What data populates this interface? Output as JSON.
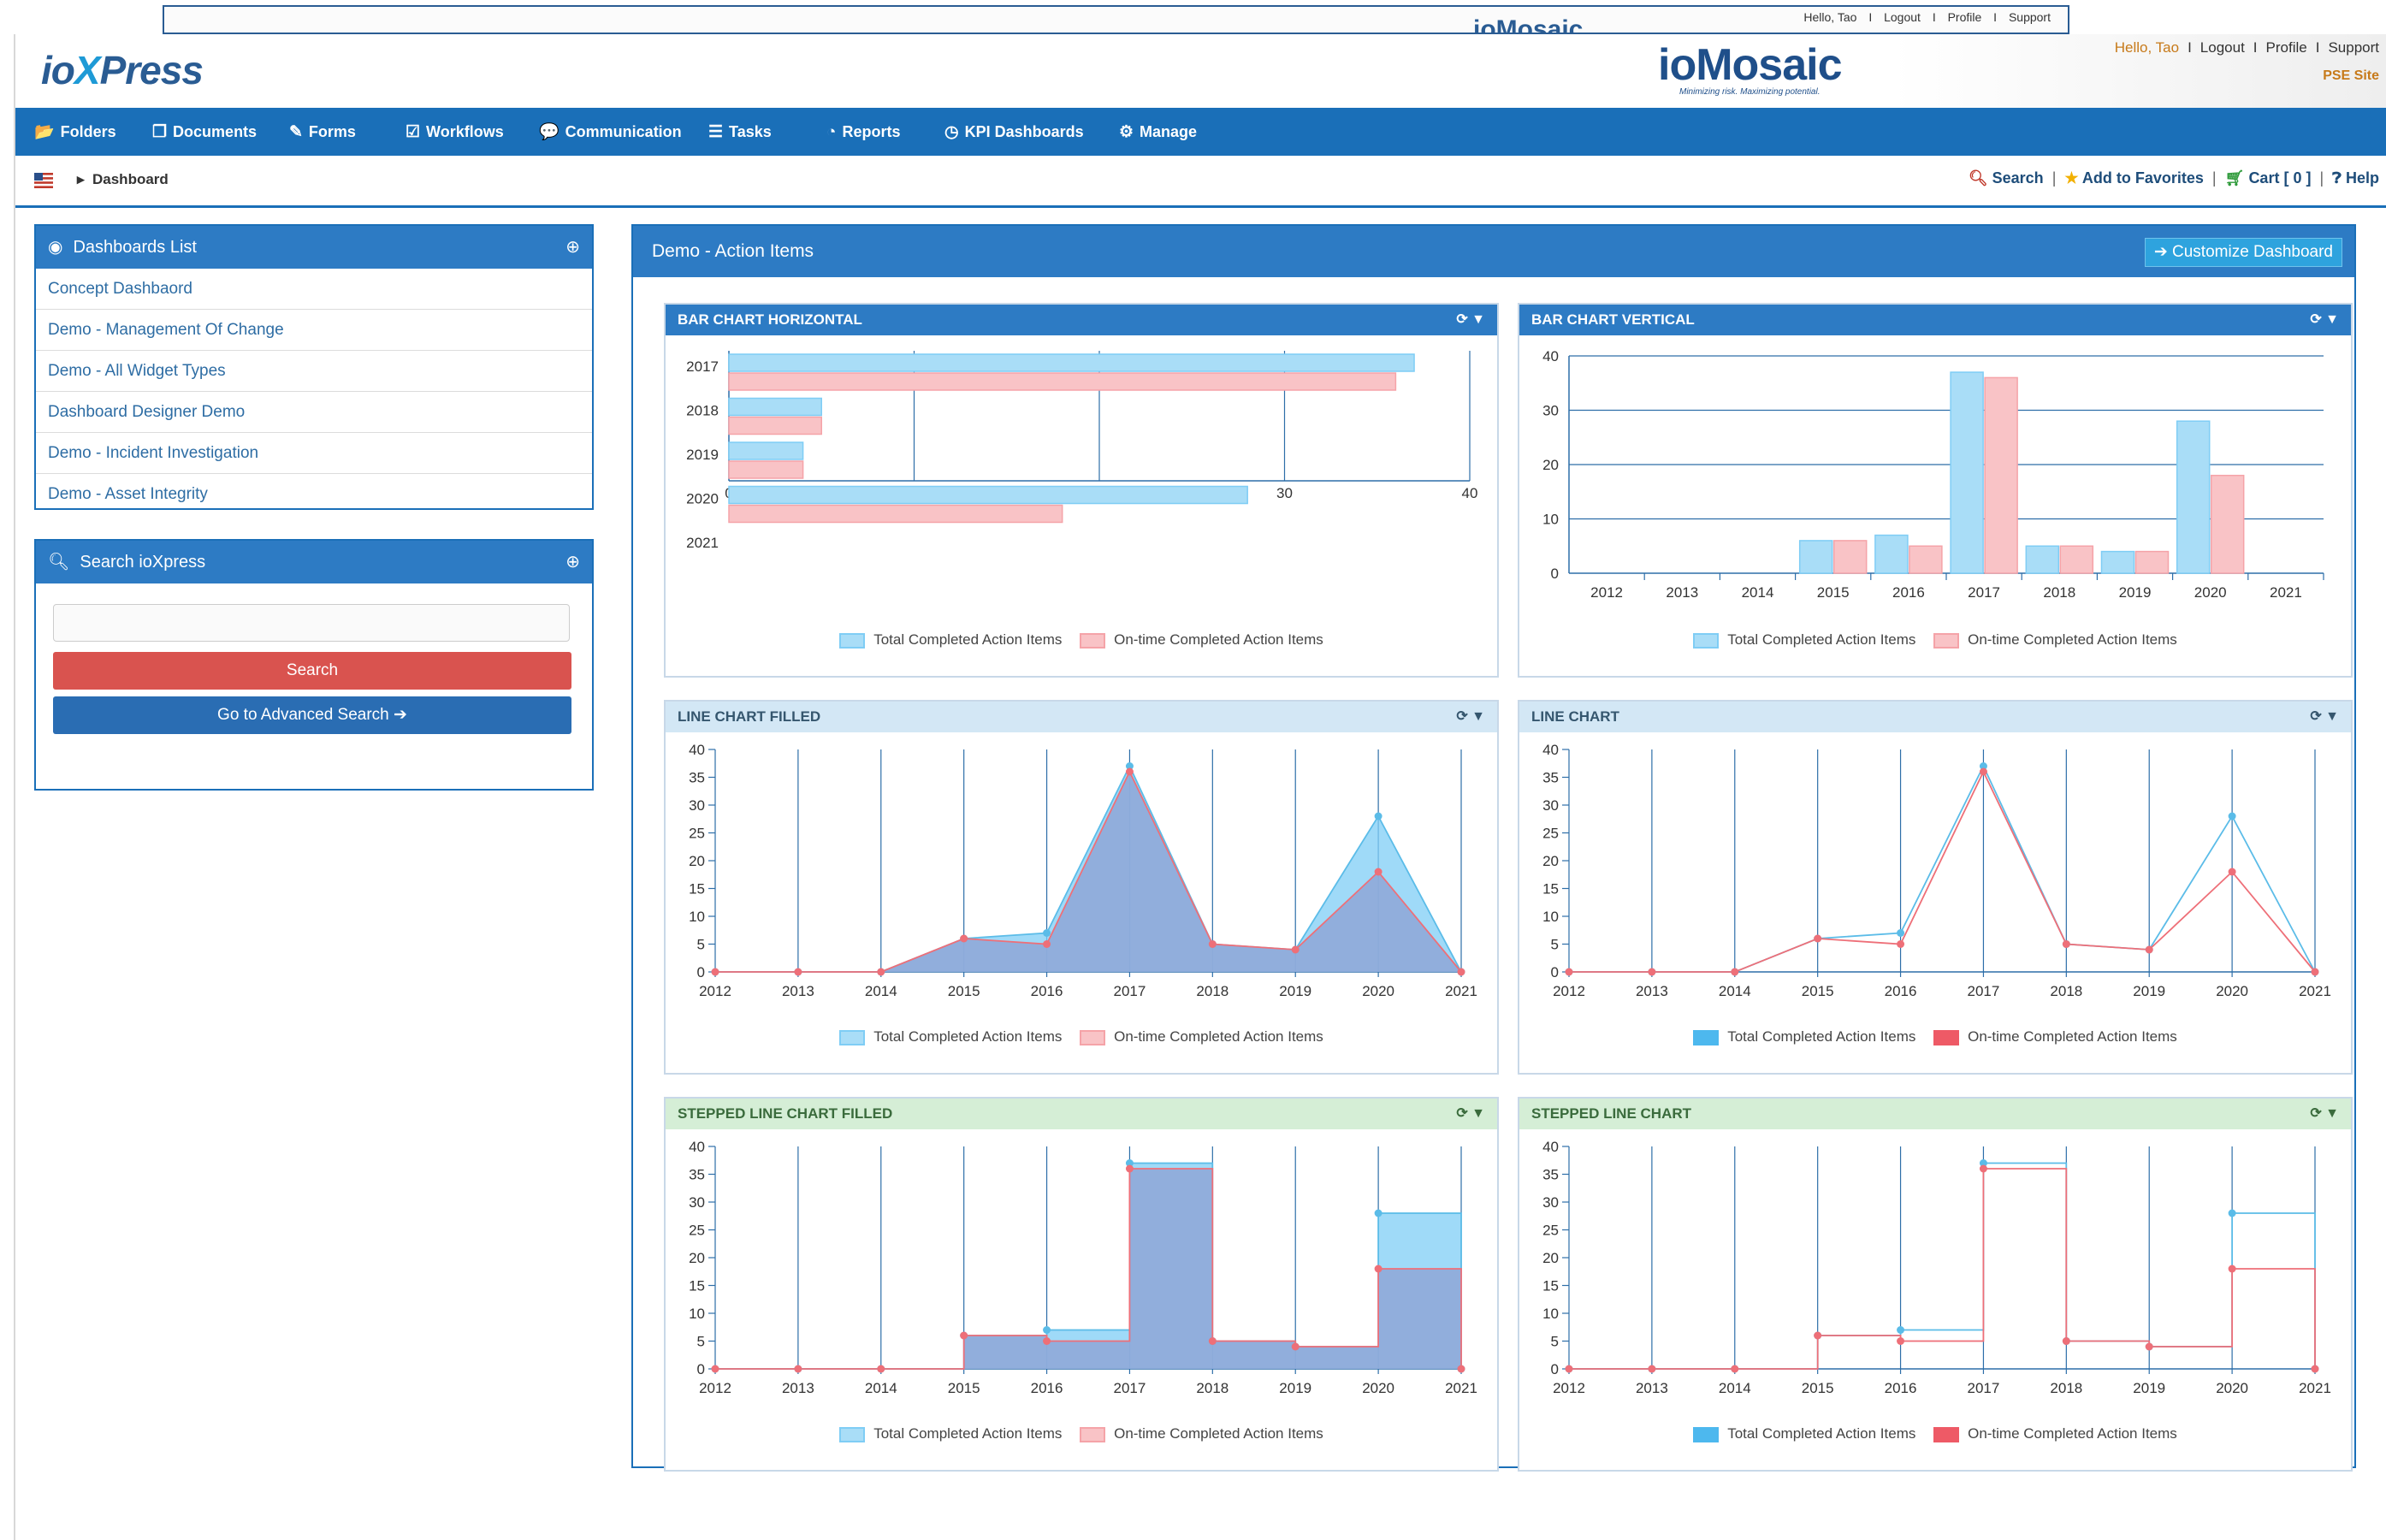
{
  "ghost": {
    "logo": "ioMosaic",
    "links": [
      "Hello, Tao",
      "I",
      "Logout",
      "I",
      "Profile",
      "I",
      "Support"
    ]
  },
  "header": {
    "logo_left": {
      "part1": "io",
      "part2": "X",
      "part3": "Press"
    },
    "logo_center": {
      "name": "ioMosaic",
      "tagline": "Minimizing risk. Maximizing potential."
    },
    "user_links": {
      "hello": "Hello, Tao",
      "logout": "Logout",
      "profile": "Profile",
      "support": "Support",
      "sep": "I"
    },
    "pse_site": "PSE Site"
  },
  "nav": {
    "items": [
      {
        "label": "Folders",
        "icon": "folder-open-icon"
      },
      {
        "label": "Documents",
        "icon": "documents-icon"
      },
      {
        "label": "Forms",
        "icon": "edit-icon"
      },
      {
        "label": "Workflows",
        "icon": "check-square-icon"
      },
      {
        "label": "Communication",
        "icon": "comments-icon"
      },
      {
        "label": "Tasks",
        "icon": "list-icon"
      },
      {
        "label": "Reports",
        "icon": "pie-chart-icon"
      },
      {
        "label": "KPI Dashboards",
        "icon": "tachometer-icon"
      },
      {
        "label": "Manage",
        "icon": "cogs-icon"
      }
    ]
  },
  "breadcrumb": {
    "current": "Dashboard"
  },
  "toolbar": {
    "search": "Search",
    "favorites": "Add to Favorites",
    "cart": "Cart [ 0 ]",
    "help": "Help",
    "pipe": "|"
  },
  "sidebar": {
    "dashboards_title": "Dashboards List",
    "dashboards": [
      "Concept Dashbaord",
      "Demo - Management Of Change",
      "Demo - All Widget Types",
      "Dashboard Designer Demo",
      "Demo - Incident Investigation",
      "Demo - Asset Integrity"
    ],
    "search_title": "Search ioXpress",
    "search_placeholder": "",
    "search_button": "Search",
    "advanced_button": "Go to Advanced Search ➔"
  },
  "main": {
    "title": "Demo - Action Items",
    "customize": "➔ Customize Dashboard"
  },
  "widgets": [
    {
      "id": "w1",
      "title": "BAR CHART HORIZONTAL",
      "legend": [
        "Total Completed Action Items",
        "On-time Completed Action Items"
      ]
    },
    {
      "id": "w2",
      "title": "BAR CHART VERTICAL",
      "legend": [
        "Total Completed Action Items",
        "On-time Completed Action Items"
      ]
    },
    {
      "id": "w3",
      "title": "LINE CHART FILLED",
      "legend": [
        "Total Completed Action Items",
        "On-time Completed Action Items"
      ]
    },
    {
      "id": "w4",
      "title": "LINE CHART",
      "legend": [
        "Total Completed Action Items",
        "On-time Completed Action Items"
      ]
    },
    {
      "id": "w5",
      "title": "STEPPED LINE CHART FILLED",
      "legend": [
        "Total Completed Action Items",
        "On-time Completed Action Items"
      ]
    },
    {
      "id": "w6",
      "title": "STEPPED LINE CHART",
      "legend": [
        "Total Completed Action Items",
        "On-time Completed Action Items"
      ]
    }
  ],
  "colors": {
    "total": "#7fcdf5",
    "ontime": "#f5a3a8",
    "total_line": "#5bbce8",
    "ontime_line": "#ee6f78",
    "fill_overlap": "#8fa8d8",
    "axis": "#2d6ea8",
    "nav": "#1a6fb8",
    "header": "#2d7bc4"
  },
  "chart_data": [
    {
      "type": "bar",
      "orientation": "horizontal",
      "title": "BAR CHART HORIZONTAL",
      "categories": [
        "2017",
        "2018",
        "2019",
        "2020",
        "2021"
      ],
      "series": [
        {
          "name": "Total Completed Action Items",
          "values": [
            37,
            5,
            4,
            28,
            0
          ]
        },
        {
          "name": "On-time Completed Action Items",
          "values": [
            36,
            5,
            4,
            18,
            0
          ]
        }
      ],
      "xlim": [
        0,
        40
      ],
      "ticks": [
        0,
        10,
        20,
        30,
        40
      ],
      "grid": true,
      "legend": "bottom"
    },
    {
      "type": "bar",
      "orientation": "vertical",
      "title": "BAR CHART VERTICAL",
      "categories": [
        "2012",
        "2013",
        "2014",
        "2015",
        "2016",
        "2017",
        "2018",
        "2019",
        "2020",
        "2021"
      ],
      "series": [
        {
          "name": "Total Completed Action Items",
          "values": [
            0,
            0,
            0,
            6,
            7,
            37,
            5,
            4,
            28,
            0
          ]
        },
        {
          "name": "On-time Completed Action Items",
          "values": [
            0,
            0,
            0,
            6,
            5,
            36,
            5,
            4,
            18,
            0
          ]
        }
      ],
      "ylim": [
        0,
        40
      ],
      "ticks": [
        0,
        10,
        20,
        30,
        40
      ],
      "grid": true,
      "legend": "bottom"
    },
    {
      "type": "area",
      "title": "LINE CHART FILLED",
      "categories": [
        "2012",
        "2013",
        "2014",
        "2015",
        "2016",
        "2017",
        "2018",
        "2019",
        "2020",
        "2021"
      ],
      "series": [
        {
          "name": "Total Completed Action Items",
          "values": [
            0,
            0,
            0,
            6,
            7,
            37,
            5,
            4,
            28,
            0
          ]
        },
        {
          "name": "On-time Completed Action Items",
          "values": [
            0,
            0,
            0,
            6,
            5,
            36,
            5,
            4,
            18,
            0
          ]
        }
      ],
      "ylim": [
        0,
        40
      ],
      "ticks": [
        0,
        5,
        10,
        15,
        20,
        25,
        30,
        35,
        40
      ],
      "grid": true,
      "legend": "bottom"
    },
    {
      "type": "line",
      "title": "LINE CHART",
      "categories": [
        "2012",
        "2013",
        "2014",
        "2015",
        "2016",
        "2017",
        "2018",
        "2019",
        "2020",
        "2021"
      ],
      "series": [
        {
          "name": "Total Completed Action Items",
          "values": [
            0,
            0,
            0,
            6,
            7,
            37,
            5,
            4,
            28,
            0
          ]
        },
        {
          "name": "On-time Completed Action Items",
          "values": [
            0,
            0,
            0,
            6,
            5,
            36,
            5,
            4,
            18,
            0
          ]
        }
      ],
      "ylim": [
        0,
        40
      ],
      "ticks": [
        0,
        5,
        10,
        15,
        20,
        25,
        30,
        35,
        40
      ],
      "grid": true,
      "legend": "bottom"
    },
    {
      "type": "area",
      "stepped": true,
      "title": "STEPPED LINE CHART FILLED",
      "categories": [
        "2012",
        "2013",
        "2014",
        "2015",
        "2016",
        "2017",
        "2018",
        "2019",
        "2020",
        "2021"
      ],
      "series": [
        {
          "name": "Total Completed Action Items",
          "values": [
            0,
            0,
            0,
            6,
            7,
            37,
            5,
            4,
            28,
            0
          ]
        },
        {
          "name": "On-time Completed Action Items",
          "values": [
            0,
            0,
            0,
            6,
            5,
            36,
            5,
            4,
            18,
            0
          ]
        }
      ],
      "ylim": [
        0,
        40
      ],
      "ticks": [
        0,
        5,
        10,
        15,
        20,
        25,
        30,
        35,
        40
      ],
      "grid": true,
      "legend": "bottom"
    },
    {
      "type": "line",
      "stepped": true,
      "title": "STEPPED LINE CHART",
      "categories": [
        "2012",
        "2013",
        "2014",
        "2015",
        "2016",
        "2017",
        "2018",
        "2019",
        "2020",
        "2021"
      ],
      "series": [
        {
          "name": "Total Completed Action Items",
          "values": [
            0,
            0,
            0,
            6,
            7,
            37,
            5,
            4,
            28,
            0
          ]
        },
        {
          "name": "On-time Completed Action Items",
          "values": [
            0,
            0,
            0,
            6,
            5,
            36,
            5,
            4,
            18,
            0
          ]
        }
      ],
      "ylim": [
        0,
        40
      ],
      "ticks": [
        0,
        5,
        10,
        15,
        20,
        25,
        30,
        35,
        40
      ],
      "grid": true,
      "legend": "bottom"
    }
  ]
}
